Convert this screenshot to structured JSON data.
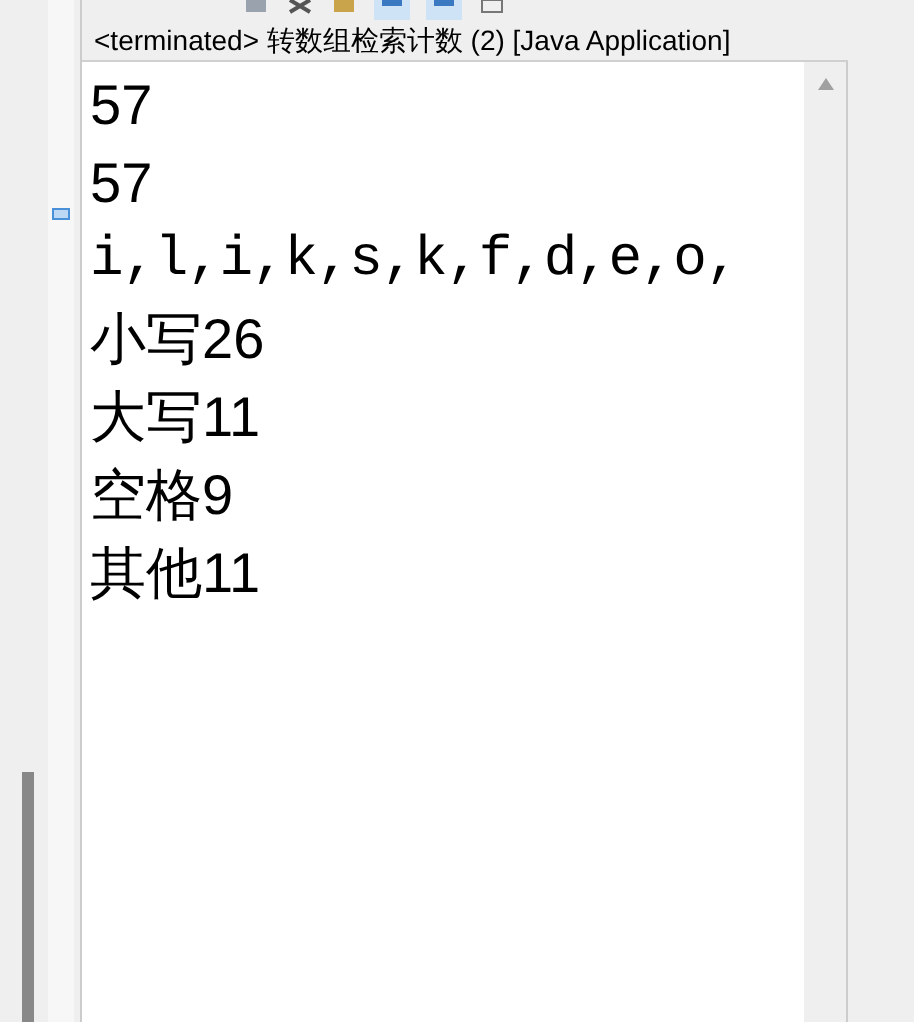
{
  "console": {
    "title": "<terminated> 转数组检索计数 (2) [Java Application]",
    "lines": [
      {
        "kind": "text",
        "text": "57"
      },
      {
        "kind": "text",
        "text": "57"
      },
      {
        "kind": "mono",
        "text": "i,l,i,k,s,k,f,d,e,o,"
      },
      {
        "kind": "text",
        "text": "小写26"
      },
      {
        "kind": "text",
        "text": "大写11"
      },
      {
        "kind": "text",
        "text": "空格9"
      },
      {
        "kind": "text",
        "text": "其他11"
      }
    ]
  }
}
